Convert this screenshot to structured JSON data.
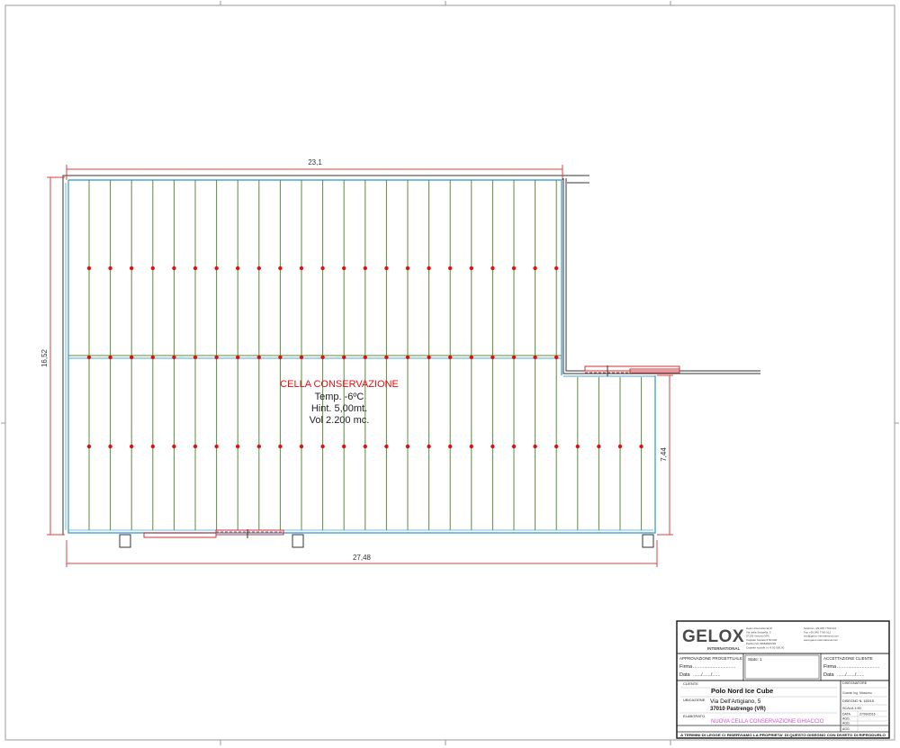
{
  "plan": {
    "dimensions": {
      "top_width": "23,1",
      "bottom_width": "27,48",
      "left_height": "16,52",
      "right_height": "7,44"
    },
    "room": {
      "name": "CELLA CONSERVAZIONE",
      "temp": "Temp. -6ºC",
      "height": "Hint. 5,00mt.",
      "volume": "Vol 2.200 mc."
    }
  },
  "title_block": {
    "logo": "GELOX",
    "logo_sub": "INTERNATIONAL",
    "company_lines": [
      "Gelox International srl",
      "Via della Stradella, 3",
      "37135 Verona (VR)",
      "Capitale Sociale € 50.000",
      "Partita IVA 03584820238",
      "Capitale sociale i.v. € 50.000,00"
    ],
    "contact_lines": [
      "Telefono +39 045 7700 011",
      "Fax +39 045 7700 012",
      "info@gelox-international.com",
      "www.gelox-international.com"
    ],
    "approval_title": "APPROVAZIONE PROGETTUALE",
    "firma_label": "Firma",
    "data_label": "Data",
    "firma_line": "...............................",
    "data_line": "....../....../......",
    "stato_label": "Stato: 1",
    "accept_title": "ACCETTAZIONE CLIENTE",
    "cliente_label": "CLIENTE",
    "cliente_value": "Polo Nord Ice Cube",
    "ubicazione_label": "UBICAZIONE",
    "ubicazione_line1": "Via Dell'Artigiano, 5",
    "ubicazione_line2": "37010 Pastrengo (VR)",
    "elaborato_label": "ELABORATO",
    "elaborato_value": "NUOVA CELLA CONSERVAZIONE GHIACCIO",
    "disegnatore_label": "DISEGNATORE",
    "disegnatore_value": "Guarisi Ing. Massimo",
    "disegno_label": "DISEGNO N. 150/15",
    "scala_label": "SCALA 1:50",
    "data_field": "DATA",
    "data_value": "27/09/2016",
    "agg_labels": [
      "AGG.",
      "AGG.",
      "AGG."
    ],
    "footer": "A TERMINI DI LEGGE CI RISERVIAMO LA PROPRIETA' DI QUESTO DISEGNO CON DIVIETO DI RIPRODURLO"
  },
  "colors": {
    "frame": "#999999",
    "dimension": "#d94040",
    "wall_outer": "#333333",
    "panel_edge": "#4aa8d8",
    "rail": "#5b8c3a",
    "marker": "#e01010",
    "door": "#d03030",
    "room_title": "#e01010",
    "elaborato_text": "#d050d0"
  }
}
